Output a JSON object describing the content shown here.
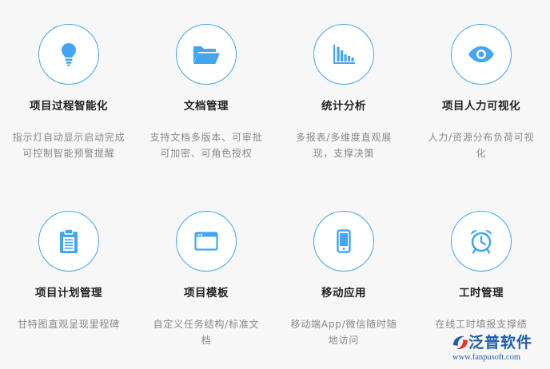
{
  "colors": {
    "accent": "#43a6f0",
    "title": "#222222",
    "description": "#888888",
    "background": "#f7f7f7",
    "watermark": "#1f5fa8"
  },
  "features": [
    {
      "icon": "lightbulb-icon",
      "title": "项目过程智能化",
      "description": "指示灯自动显示启动完成可控制智能预警提醒"
    },
    {
      "icon": "folder-icon",
      "title": "文档管理",
      "description": "支持文档多版本、可审批可加密、可角色授权"
    },
    {
      "icon": "bar-chart-icon",
      "title": "统计分析",
      "description": "多报表/多维度直观展现，支撑决策"
    },
    {
      "icon": "eye-icon",
      "title": "项目人力可视化",
      "description": "人力/资源分布负荷可视化"
    },
    {
      "icon": "clipboard-icon",
      "title": "项目计划管理",
      "description": "甘特图直观呈现里程碑"
    },
    {
      "icon": "template-window-icon",
      "title": "项目模板",
      "description": "自定义任务结构/标准文档"
    },
    {
      "icon": "mobile-phone-icon",
      "title": "移动应用",
      "description": "移动端App/微信随时随地访问"
    },
    {
      "icon": "alarm-clock-icon",
      "title": "工时管理",
      "description": "在线工时填报支撑绩"
    }
  ],
  "watermark": {
    "brand": "泛普软件",
    "url": "www.fanpusoft.com"
  }
}
